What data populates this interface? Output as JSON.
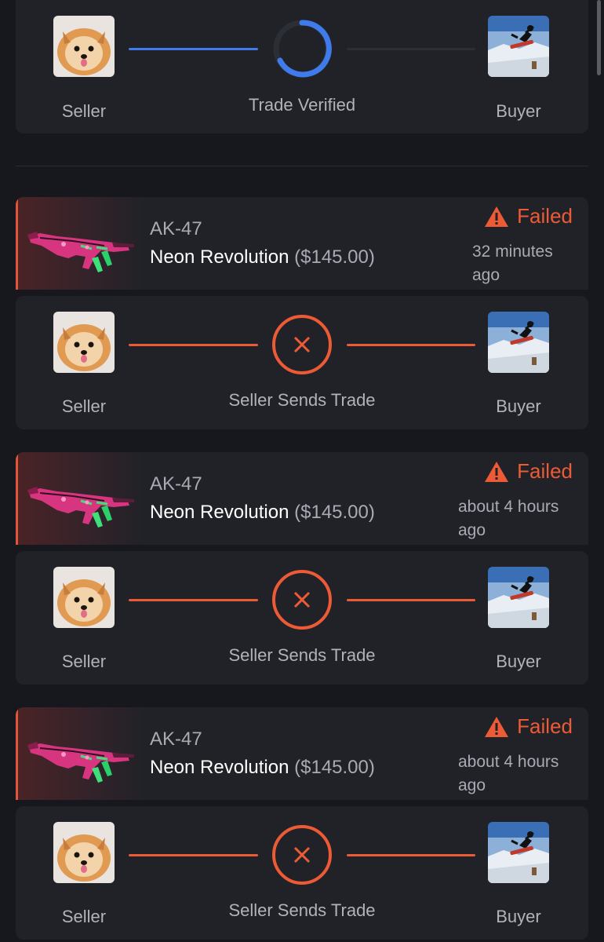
{
  "colors": {
    "background": "#17181d",
    "card": "#212228",
    "accent_failed": "#ec5a36",
    "progress_blue": "#3f7bea",
    "pending_line": "#2c2e36"
  },
  "top_progress": {
    "seller_label": "Seller",
    "buyer_label": "Buyer",
    "step_label": "Trade Verified",
    "step_icon": "spinner-icon"
  },
  "trades": [
    {
      "item_name": "AK-47",
      "skin_name": "Neon Revolution",
      "price": "($145.00)",
      "status": "Failed",
      "status_icon": "warning-icon",
      "time": "32 minutes ago",
      "seller_label": "Seller",
      "buyer_label": "Buyer",
      "step_label": "Seller Sends Trade",
      "step_icon": "close-icon"
    },
    {
      "item_name": "AK-47",
      "skin_name": "Neon Revolution",
      "price": "($145.00)",
      "status": "Failed",
      "status_icon": "warning-icon",
      "time": "about 4 hours ago",
      "seller_label": "Seller",
      "buyer_label": "Buyer",
      "step_label": "Seller Sends Trade",
      "step_icon": "close-icon"
    },
    {
      "item_name": "AK-47",
      "skin_name": "Neon Revolution",
      "price": "($145.00)",
      "status": "Failed",
      "status_icon": "warning-icon",
      "time": "about 4 hours ago",
      "seller_label": "Seller",
      "buyer_label": "Buyer",
      "step_label": "Seller Sends Trade",
      "step_icon": "close-icon"
    }
  ]
}
